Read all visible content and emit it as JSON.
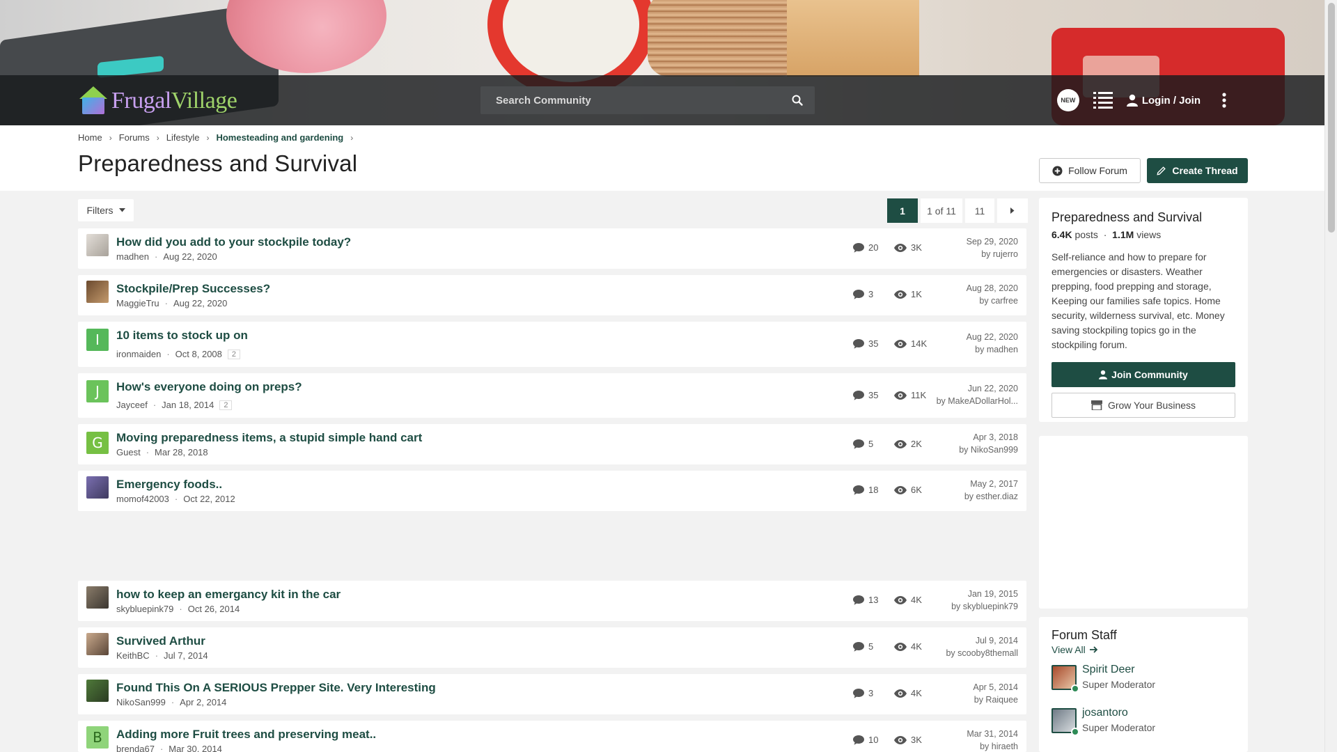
{
  "header": {
    "logo_text_a": "Frugal",
    "logo_text_b": "Village",
    "search_placeholder": "Search Community",
    "new_badge": "NEW",
    "login_label": "Login / Join"
  },
  "breadcrumb": [
    "Home",
    "Forums",
    "Lifestyle",
    "Homesteading and gardening"
  ],
  "page": {
    "title": "Preparedness and Survival",
    "follow_label": "Follow Forum",
    "create_label": "Create Thread",
    "filters_label": "Filters"
  },
  "pagination": {
    "current": "1",
    "of": "1 of 11",
    "last": "11"
  },
  "threads": [
    {
      "title": "How did you add to your stockpile today?",
      "author": "madhen",
      "date": "Aug 22, 2020",
      "replies": "20",
      "views": "3K",
      "last_date": "Sep 29, 2020",
      "last_by": "by rujerro",
      "avatar": "photo"
    },
    {
      "title": "Stockpile/Prep Successes?",
      "author": "MaggieTru",
      "date": "Aug 22, 2020",
      "replies": "3",
      "views": "1K",
      "last_date": "Aug 28, 2020",
      "last_by": "by carfree",
      "avatar": "photo"
    },
    {
      "title": "10 items to stock up on",
      "author": "ironmaiden",
      "date": "Oct 8, 2008",
      "pages": "2",
      "replies": "35",
      "views": "14K",
      "last_date": "Aug 22, 2020",
      "last_by": "by madhen",
      "avatar": "I"
    },
    {
      "title": "How's everyone doing on preps?",
      "author": "Jayceef",
      "date": "Jan 18, 2014",
      "pages": "2",
      "replies": "35",
      "views": "11K",
      "last_date": "Jun 22, 2020",
      "last_by": "by MakeADollarHol...",
      "avatar": "J"
    },
    {
      "title": "Moving preparedness items, a stupid simple hand cart",
      "author": "Guest",
      "date": "Mar 28, 2018",
      "replies": "5",
      "views": "2K",
      "last_date": "Apr 3, 2018",
      "last_by": "by NikoSan999",
      "avatar": "G"
    },
    {
      "title": "Emergency foods..",
      "author": "momof42003",
      "date": "Oct 22, 2012",
      "replies": "18",
      "views": "6K",
      "last_date": "May 2, 2017",
      "last_by": "by esther.diaz",
      "avatar": "photo"
    },
    {
      "title": "how to keep an emergancy kit in the car",
      "author": "skybluepink79",
      "date": "Oct 26, 2014",
      "replies": "13",
      "views": "4K",
      "last_date": "Jan 19, 2015",
      "last_by": "by skybluepink79",
      "avatar": "photo"
    },
    {
      "title": "Survived Arthur",
      "author": "KeithBC",
      "date": "Jul 7, 2014",
      "replies": "5",
      "views": "4K",
      "last_date": "Jul 9, 2014",
      "last_by": "by scooby8themall",
      "avatar": "photo"
    },
    {
      "title": "Found This On A SERIOUS Prepper Site. Very Interesting",
      "author": "NikoSan999",
      "date": "Apr 2, 2014",
      "replies": "3",
      "views": "4K",
      "last_date": "Apr 5, 2014",
      "last_by": "by Raiquee",
      "avatar": "photo"
    },
    {
      "title": "Adding more Fruit trees and preserving meat..",
      "author": "brenda67",
      "date": "Mar 30, 2014",
      "replies": "10",
      "views": "3K",
      "last_date": "Mar 31, 2014",
      "last_by": "by hiraeth",
      "avatar": "B"
    }
  ],
  "sidebar": {
    "title": "Preparedness and Survival",
    "posts_count": "6.4K",
    "posts_label": "posts",
    "views_count": "1.1M",
    "views_label": "views",
    "description": "Self-reliance and how to prepare for emergencies or disasters. Weather prepping, food prepping and storage, Keeping our families safe topics. Home security, wilderness survival, etc. Money saving stockpiling topics go in the stockpiling forum.",
    "join_label": "Join Community",
    "grow_label": "Grow Your Business",
    "staff_title": "Forum Staff",
    "view_all": "View All",
    "staff": [
      {
        "name": "Spirit Deer",
        "role": "Super Moderator"
      },
      {
        "name": "josantoro",
        "role": "Super Moderator"
      }
    ]
  },
  "colors": {
    "brand": "#1e4d43",
    "navbar": "#1a1c1e"
  },
  "icons": [
    "search-icon",
    "list-icon",
    "user-icon",
    "kebab-icon",
    "comment-icon",
    "eye-icon",
    "plus-circle-icon",
    "pencil-icon",
    "caret-down-icon",
    "chevron-right-icon",
    "store-icon",
    "arrow-right-icon"
  ]
}
